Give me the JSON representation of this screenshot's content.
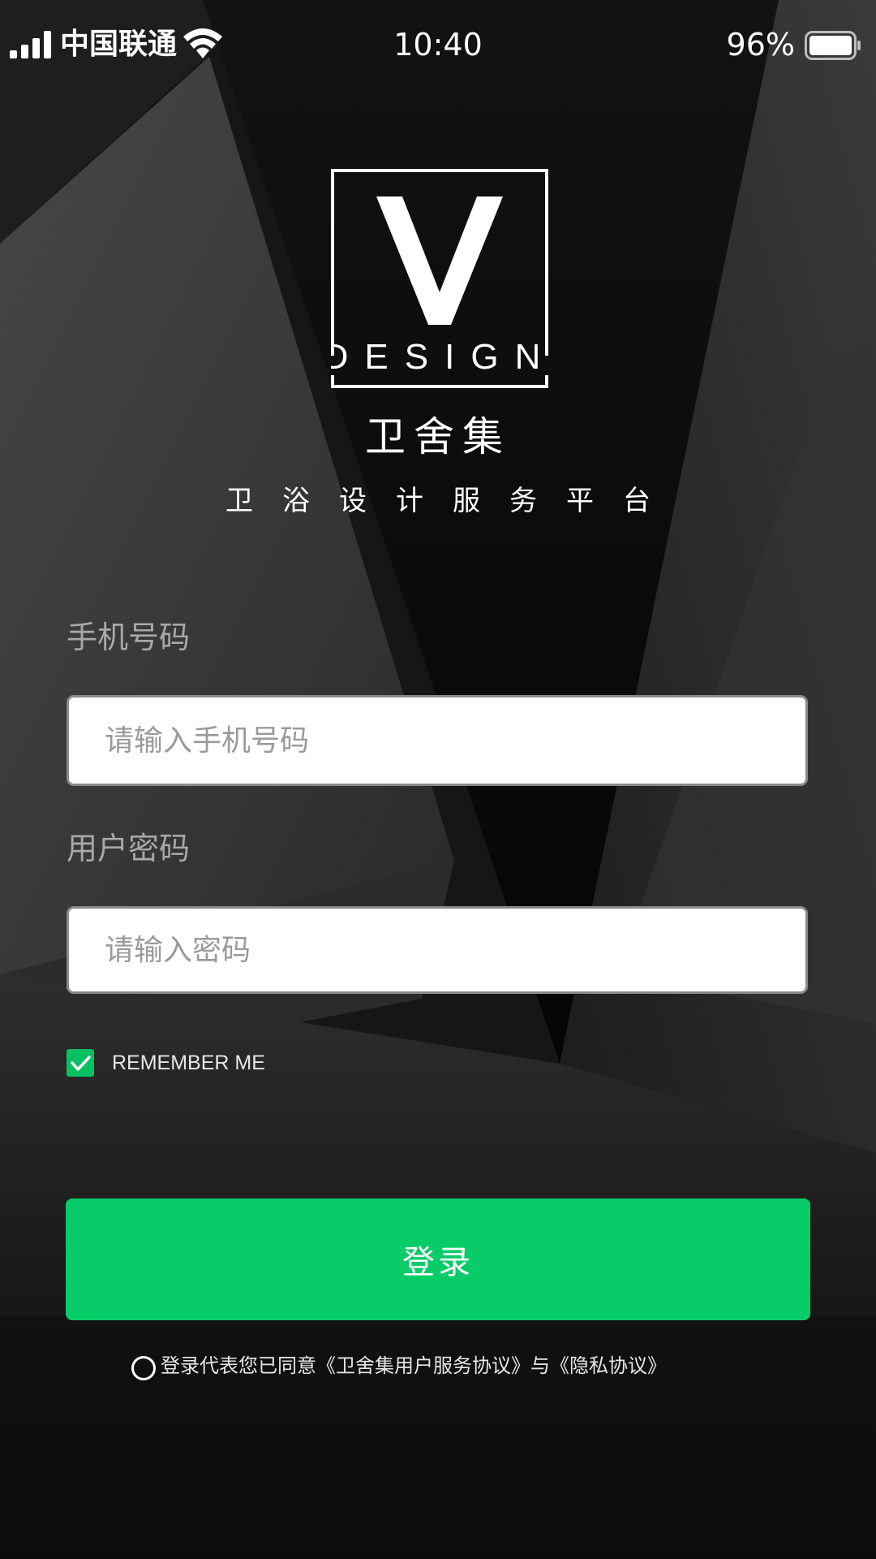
{
  "status_bar": {
    "carrier": "中国联通",
    "time": "10:40",
    "battery_percent": "96%",
    "battery_level": 0.96,
    "signal_icon": "cellular-signal-icon",
    "wifi_icon": "wifi-icon",
    "battery_icon": "battery-icon"
  },
  "brand": {
    "logo_letter": "V",
    "logo_word": "DESIGN",
    "name": "卫舍集",
    "tagline": "卫浴设计服务平台"
  },
  "form": {
    "phone_label": "手机号码",
    "phone_placeholder": "请输入手机号码",
    "phone_value": "",
    "password_label": "用户密码",
    "password_placeholder": "请输入密码",
    "password_value": "",
    "remember_label": "REMEMBER ME",
    "remember_checked": true,
    "login_label": "登录",
    "agreement_text": "登录代表您已同意《卫舍集用户服务协议》与《隐私协议》",
    "agreement_checked": false
  },
  "colors": {
    "accent_green": "#07cc68",
    "checkbox_green": "#07c160",
    "background_dark": "#101010"
  }
}
